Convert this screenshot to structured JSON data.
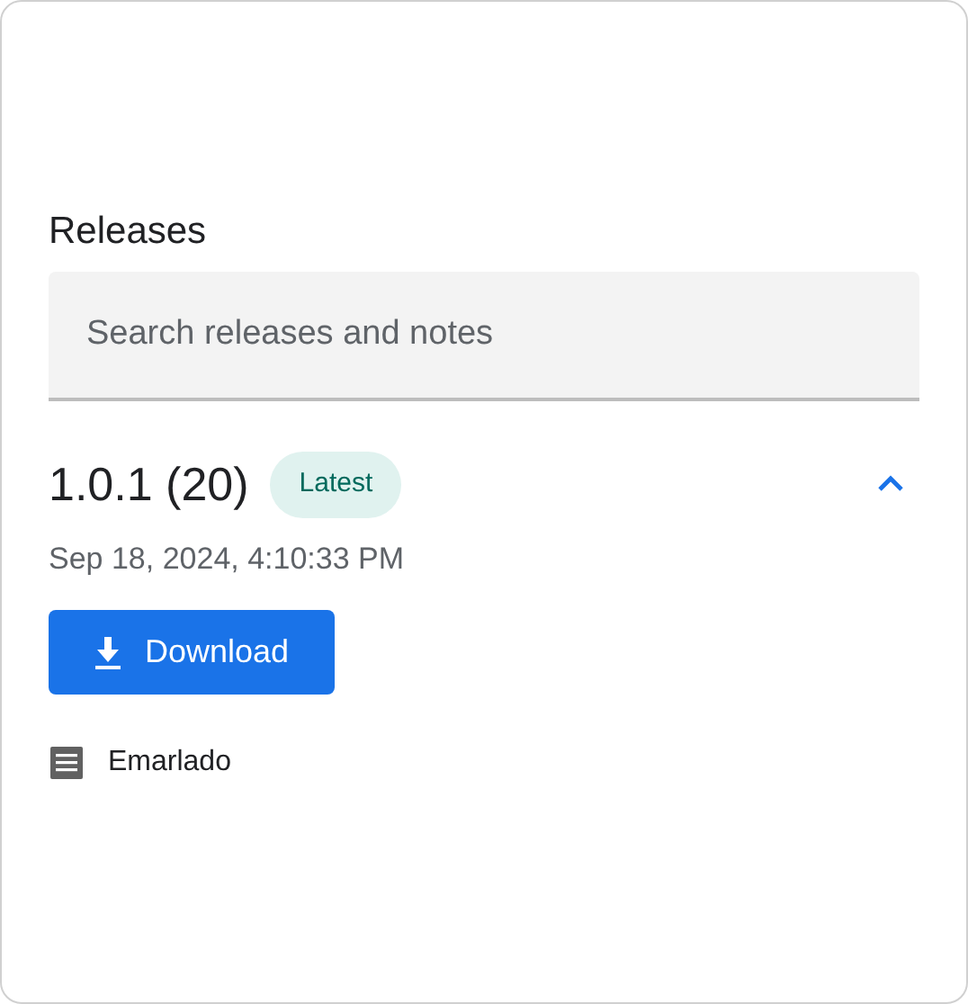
{
  "section": {
    "title": "Releases"
  },
  "search": {
    "placeholder": "Search releases and notes"
  },
  "releases": [
    {
      "version": "1.0.1 (20)",
      "badge": "Latest",
      "expanded": true,
      "date": "Sep 18, 2024, 4:10:33 PM",
      "download_label": "Download",
      "notes": "Emarlado"
    }
  ]
}
